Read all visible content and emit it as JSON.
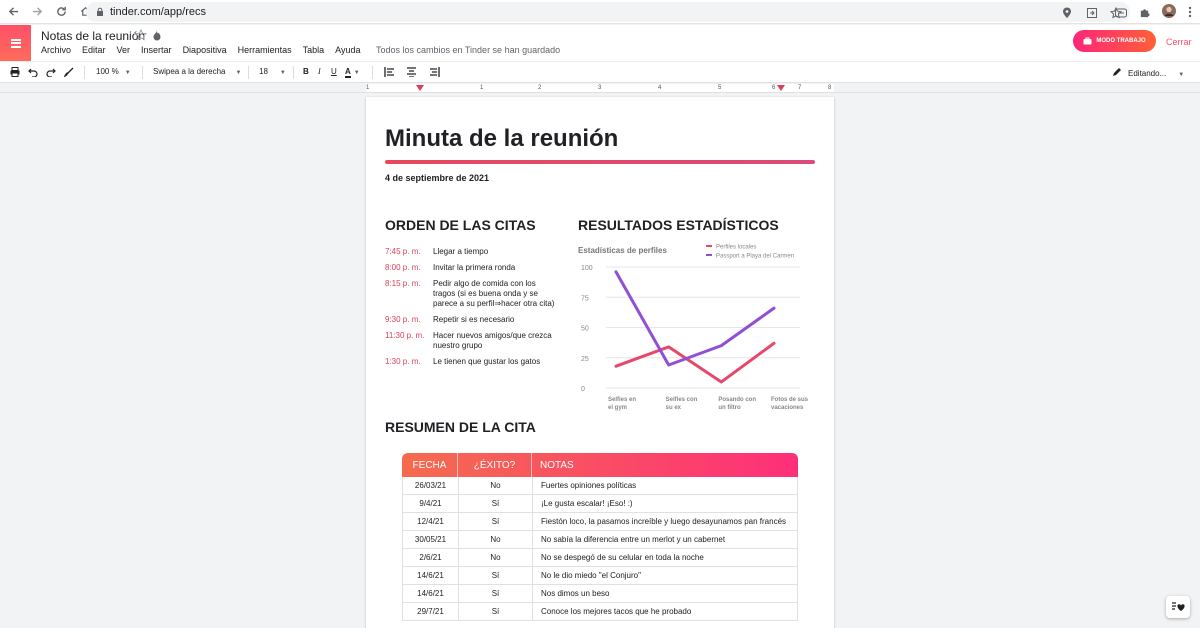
{
  "browser": {
    "url": "tinder.com/app/recs"
  },
  "app": {
    "doc_title": "Notas de la reunión",
    "menu": [
      "Archivo",
      "Editar",
      "Ver",
      "Insertar",
      "Diapositiva",
      "Herramientas",
      "Tabla",
      "Ayuda"
    ],
    "saved_message": "Todos los cambios en Tinder se han guardado",
    "work_mode_label": "MODO TRABAJO",
    "close_label": "Cerrar",
    "accent": "#fd5068"
  },
  "toolbar": {
    "zoom": "100 %",
    "style": "Swipea a la derecha",
    "font_size": "18",
    "editing": "Editando..."
  },
  "ruler": {
    "numbers": [
      "1",
      "1",
      "2",
      "3",
      "4",
      "5",
      "6",
      "7",
      "8"
    ]
  },
  "doc": {
    "title": "Minuta de la reunión",
    "date": "4 de septiembre de 2021",
    "schedule_heading": "ORDEN DE LAS CITAS",
    "stats_heading": "RESULTADOS ESTADÍSTICOS",
    "summary_heading": "RESUMEN DE LA CITA",
    "schedule": [
      {
        "time": "7:45  p. m.",
        "activity": "Llegar a tiempo"
      },
      {
        "time": "8:00  p. m.",
        "activity": "Invitar la primera ronda"
      },
      {
        "time": "8:15  p. m.",
        "activity": "Pedir algo de comida con los tragos (si es buena onda y se parece a su perfil⇒hacer otra cita)"
      },
      {
        "time": "9:30  p. m.",
        "activity": "Repetir si es necesario"
      },
      {
        "time": "11:30  p. m.",
        "activity": "Hacer nuevos amigos/que crezca nuestro grupo"
      },
      {
        "time": "1:30  p. m.",
        "activity": "Le tienen que gustar los gatos"
      }
    ],
    "table": {
      "headers": [
        "FECHA",
        "¿ÉXITO?",
        "NOTAS"
      ],
      "rows": [
        {
          "date": "26/03/21",
          "success": "No",
          "note": "Fuertes opiniones políticas"
        },
        {
          "date": "9/4/21",
          "success": "Sí",
          "note": "¡Le gusta escalar! ¡Eso! :)"
        },
        {
          "date": "12/4/21",
          "success": "Sí",
          "note": "Fiestón loco, la pasamos increíble y luego desayunamos pan francés"
        },
        {
          "date": "30/05/21",
          "success": "No",
          "note": "No sabía la diferencia entre un merlot y un cabernet"
        },
        {
          "date": "2/6/21",
          "success": "No",
          "note": "No se despegó de su celular en toda la noche"
        },
        {
          "date": "14/6/21",
          "success": "Sí",
          "note": "No le dio miedo \"el Conjuro\""
        },
        {
          "date": "14/6/21",
          "success": "Sí",
          "note": "Nos dimos un beso"
        },
        {
          "date": "29/7/21",
          "success": "Sí",
          "note": "Conoce los mejores tacos que he probado"
        }
      ]
    }
  },
  "chart_data": {
    "type": "line",
    "title": "Estadísticas de perfiles",
    "categories": [
      "Selfies en el gym",
      "Selfies con su ex",
      "Posando con un filtro",
      "Fotos de sus vacaciones"
    ],
    "category_lines": [
      [
        "Selfies en",
        "el gym"
      ],
      [
        "Selfies con",
        "su ex"
      ],
      [
        "Posando con",
        "un filtro"
      ],
      [
        "Fotos de sus",
        "vacaciones"
      ]
    ],
    "ylim": [
      0,
      100
    ],
    "yticks": [
      "0",
      "25",
      "50",
      "75",
      "100"
    ],
    "legend_position": "top-right",
    "series": [
      {
        "name": "Perfiles locales",
        "color": "#e8476a",
        "values": [
          18,
          34,
          5,
          37
        ]
      },
      {
        "name": "Passport a Playa del Carmen",
        "color": "#8f4fd6",
        "values": [
          96,
          19,
          35,
          66
        ]
      }
    ]
  }
}
